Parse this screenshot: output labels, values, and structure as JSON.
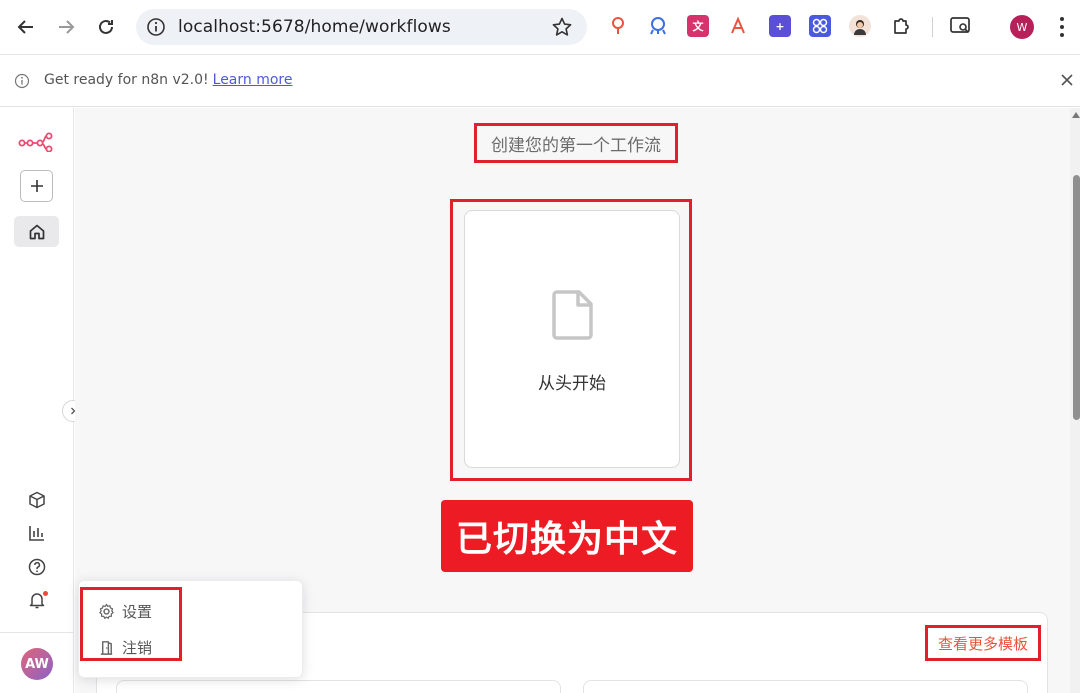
{
  "browser": {
    "url": "localhost:5678/home/workflows",
    "profile_initial": "W"
  },
  "banner": {
    "text": "Get ready for n8n v2.0!",
    "link": "Learn more"
  },
  "sidebar": {
    "avatar_initials": "AW"
  },
  "main": {
    "heading": "创建您的第一个工作流",
    "start_card_label": "从头开始",
    "overlay_label": "已切换为中文",
    "more_templates_link": "查看更多模板"
  },
  "user_menu": {
    "items": [
      {
        "label": "设置",
        "icon": "gear-icon"
      },
      {
        "label": "注销",
        "icon": "logout-door-icon"
      }
    ]
  },
  "colors": {
    "accent": "#ea4b71",
    "annotation_red": "#e0202a",
    "link_orange": "#e8543e"
  }
}
